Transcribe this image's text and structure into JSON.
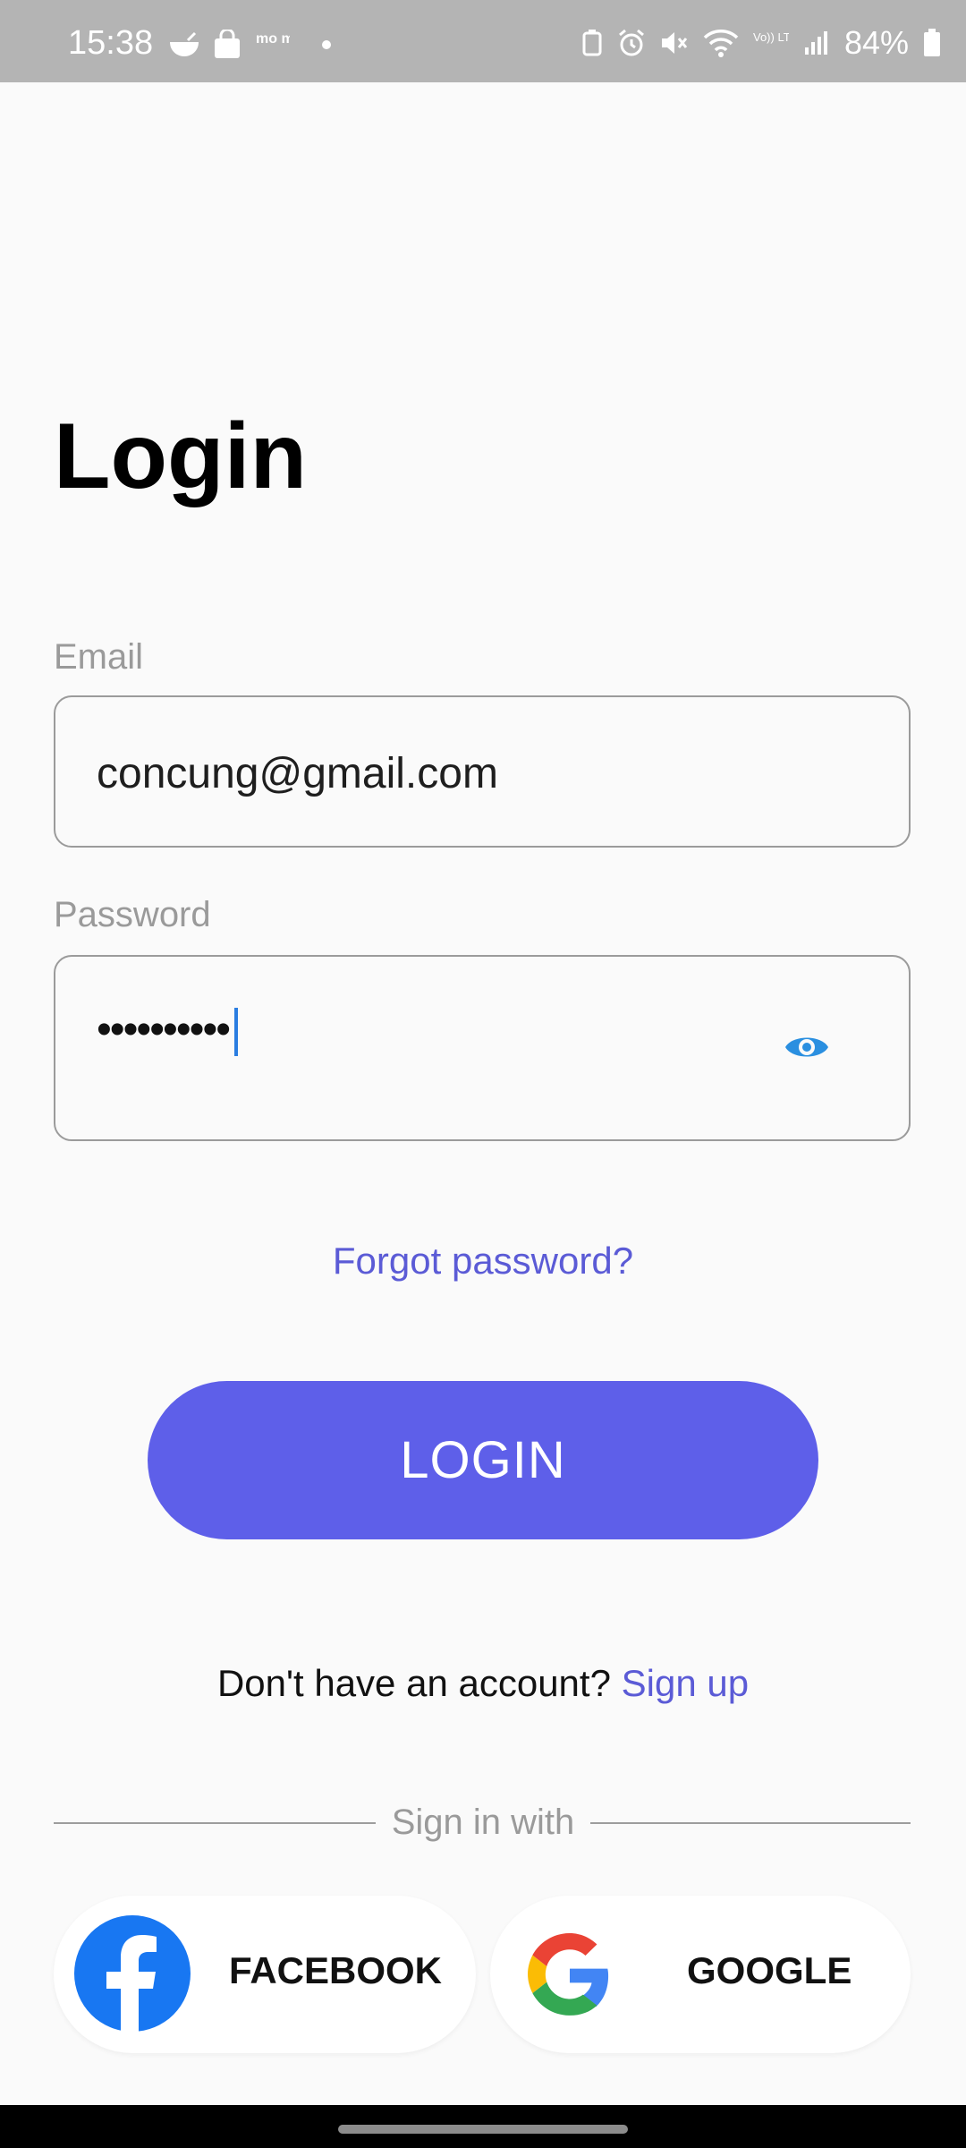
{
  "status_bar": {
    "time": "15:38",
    "battery": "84%",
    "left_icons": [
      "bowl-icon",
      "shopping-bag-icon",
      "momo-icon"
    ],
    "right_icons": [
      "battery-saver-icon",
      "alarm-icon",
      "mute-icon",
      "wifi-icon",
      "volte-icon",
      "signal-icon",
      "battery-icon"
    ],
    "momo_text": "mo mo",
    "volte_text": "Vo)) LTE1"
  },
  "page": {
    "title": "Login"
  },
  "email": {
    "label": "Email",
    "value": "concung@gmail.com"
  },
  "password": {
    "label": "Password",
    "masked_value": "••••••••••"
  },
  "forgot_password": "Forgot password?",
  "login_button": "LOGIN",
  "signup": {
    "prompt": "Don't have an account? ",
    "link": "Sign up"
  },
  "social": {
    "divider_text": "Sign in with",
    "facebook_label": "FACEBOOK",
    "google_label": "GOOGLE"
  },
  "colors": {
    "accent": "#5e5fe9",
    "link": "#5b5bd6",
    "eye_icon": "#2a8fe0",
    "facebook": "#1877f2"
  }
}
